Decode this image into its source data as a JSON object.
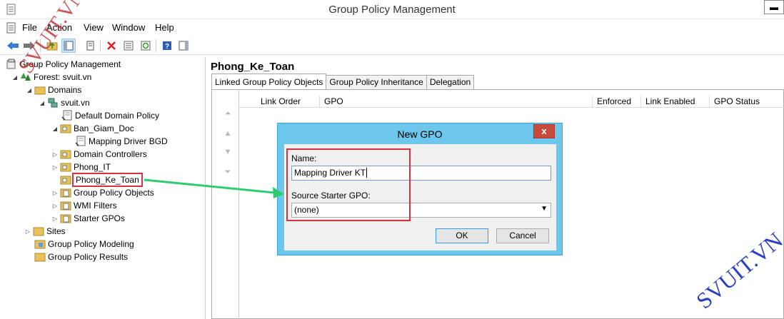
{
  "window": {
    "title": "Group Policy Management"
  },
  "menu": [
    "File",
    "Action",
    "View",
    "Window",
    "Help"
  ],
  "tree": {
    "root": "Group Policy Management",
    "forest": "Forest: svuit.vn",
    "domains": "Domains",
    "domain": "svuit.vn",
    "items": [
      "Default Domain Policy",
      "Ban_Giam_Doc",
      "Mapping Driver BGD",
      "Domain Controllers",
      "Phong_IT",
      "Phong_Ke_Toan",
      "Group Policy Objects",
      "WMI Filters",
      "Starter GPOs"
    ],
    "sites": "Sites",
    "modeling": "Group Policy Modeling",
    "results": "Group Policy Results"
  },
  "right": {
    "title": "Phong_Ke_Toan",
    "tabs": [
      "Linked Group Policy Objects",
      "Group Policy Inheritance",
      "Delegation"
    ],
    "columns": [
      "Link Order",
      "GPO",
      "Enforced",
      "Link Enabled",
      "GPO Status"
    ]
  },
  "dialog": {
    "title": "New GPO",
    "close": "x",
    "name_label": "Name:",
    "name_value": "Mapping Driver KT",
    "source_label": "Source Starter GPO:",
    "source_value": "(none)",
    "ok": "OK",
    "cancel": "Cancel"
  },
  "watermark": {
    "left": "SVUIT.VN",
    "right": "SVUIT.VN"
  },
  "colors": {
    "dialog_frame": "#6dc7ec",
    "highlight": "#d9313d",
    "arrow": "#2ecc71"
  }
}
